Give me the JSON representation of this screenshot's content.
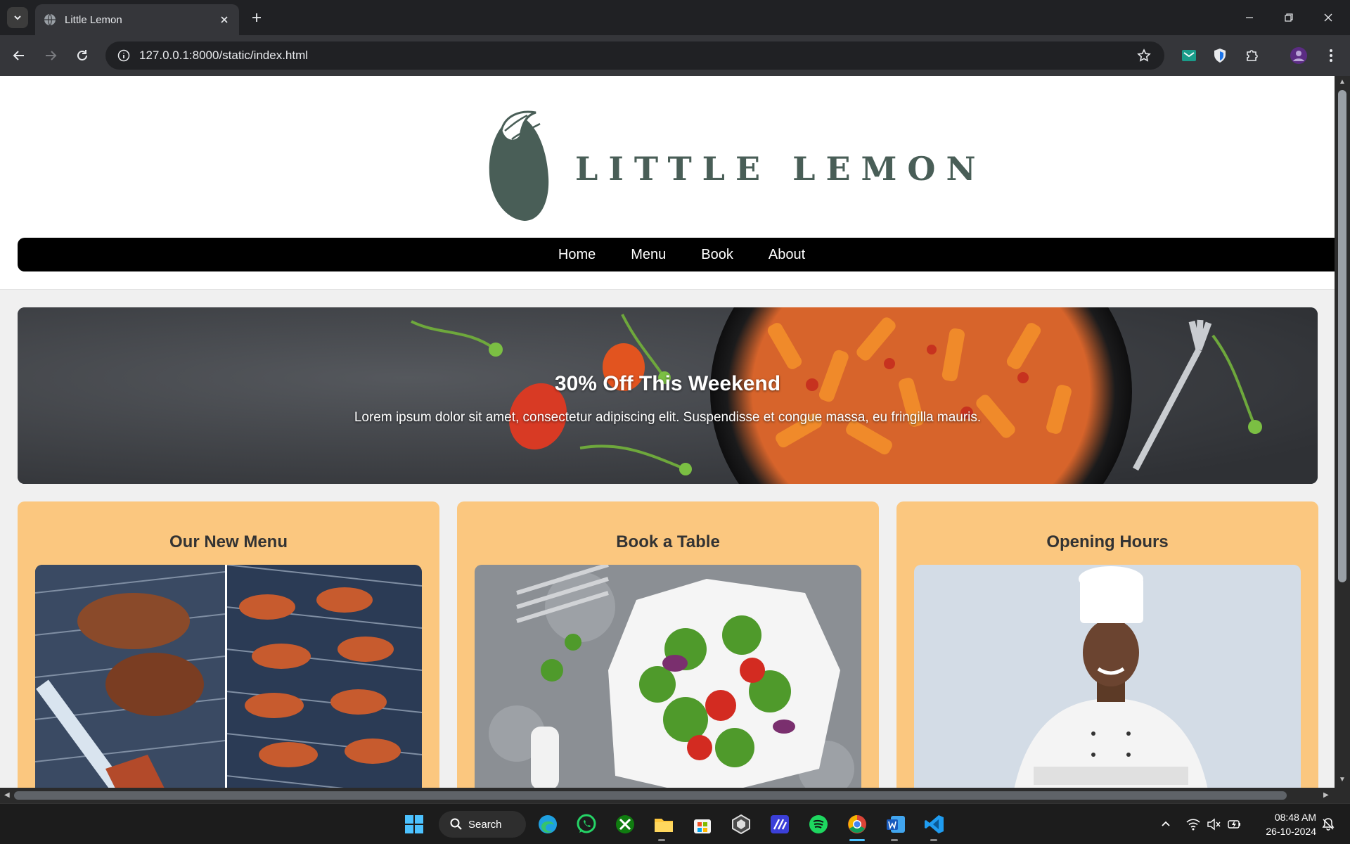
{
  "browser": {
    "tab_title": "Little Lemon",
    "url": "127.0.0.1:8000/static/index.html"
  },
  "site": {
    "logo_text": "LITTLE LEMON",
    "nav": [
      "Home",
      "Menu",
      "Book",
      "About"
    ],
    "hero": {
      "title": "30% Off This Weekend",
      "text": "Lorem ipsum dolor sit amet, consectetur adipiscing elit. Suspendisse et congue massa, eu fringilla mauris."
    },
    "cards": [
      {
        "title": "Our New Menu"
      },
      {
        "title": "Book a Table"
      },
      {
        "title": "Opening Hours"
      }
    ],
    "colors": {
      "brand_green": "#495e57",
      "nav_black": "#000000",
      "card_yellow": "#fbc77f",
      "page_bg": "#f0f0f0"
    }
  },
  "taskbar": {
    "search_label": "Search",
    "time": "08:48 AM",
    "date": "26-10-2024",
    "pinned_icons": [
      "windows-start-icon",
      "edge-icon",
      "whatsapp-icon",
      "xbox-icon",
      "file-explorer-icon",
      "microsoft-store-icon",
      "unity-icon",
      "ide-app-icon",
      "spotify-icon",
      "chrome-icon",
      "word-icon",
      "vscode-icon"
    ]
  }
}
